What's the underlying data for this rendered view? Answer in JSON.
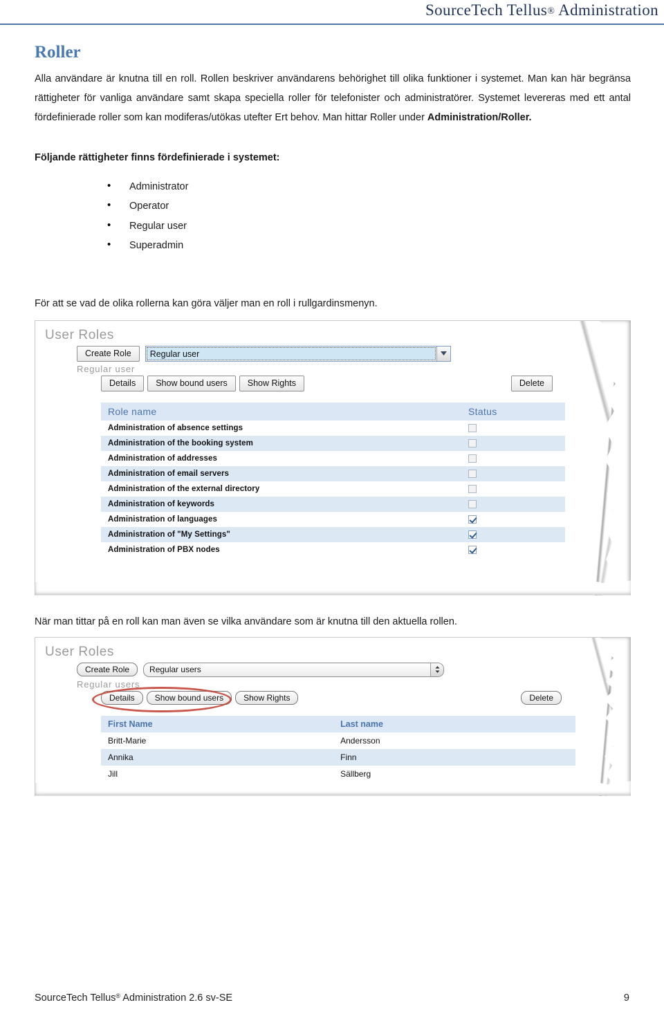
{
  "header": {
    "title": "SourceTech Tellus",
    "registered": "®",
    "title_tail": " Administration"
  },
  "section": {
    "heading": "Roller",
    "paragraph_1": "Alla användare är knutna till en roll. Rollen beskriver användarens behörighet till olika funktioner i systemet. Man kan här begränsa rättigheter för vanliga användare samt skapa speciella roller för telefonister och administratörer. Systemet levereras med ett antal fördefinierade roller som kan modiferas/utökas utefter Ert behov. Man hittar Roller under ",
    "paragraph_1_bold": "Administration/Roller.",
    "lead": "Följande rättigheter finns fördefinierade i systemet:",
    "bullets": [
      "Administrator",
      "Operator",
      "Regular user",
      "Superadmin"
    ],
    "after_bullets": "För att se vad de olika rollerna kan göra väljer man en roll i rullgardinsmenyn.",
    "between_shots": "När man tittar på en roll kan man även se vilka användare som är knutna till den aktuella rollen."
  },
  "shot1": {
    "title": "User Roles",
    "create_role_label": "Create Role",
    "dropdown_value": "Regular user",
    "dropdown_icon": "chevron-down-icon",
    "role_label": "Regular user",
    "buttons": {
      "details": "Details",
      "show_bound_users": "Show bound users",
      "show_rights": "Show Rights",
      "delete": "Delete"
    },
    "table": {
      "columns": [
        "Role name",
        "Status"
      ],
      "rows": [
        {
          "name": "Administration of absence settings",
          "checked": false
        },
        {
          "name": "Administration of the booking system",
          "checked": false
        },
        {
          "name": "Administration of addresses",
          "checked": false
        },
        {
          "name": "Administration of email servers",
          "checked": false
        },
        {
          "name": "Administration of the external directory",
          "checked": false
        },
        {
          "name": "Administration of keywords",
          "checked": false
        },
        {
          "name": "Administration of languages",
          "checked": true
        },
        {
          "name": "Administration of \"My Settings\"",
          "checked": true
        },
        {
          "name": "Administration of PBX nodes",
          "checked": true
        }
      ]
    }
  },
  "shot2": {
    "title": "User Roles",
    "create_role_label": "Create Role",
    "dropdown_value": "Regular users",
    "dropdown_icon": "stepper-updown-icon",
    "role_label": "Regular users",
    "buttons": {
      "details": "Details",
      "show_bound_users": "Show bound users",
      "show_rights": "Show Rights",
      "delete": "Delete"
    },
    "annotation": "red-ellipse-highlight",
    "table": {
      "columns": [
        "First Name",
        "Last name"
      ],
      "rows": [
        {
          "first": "Britt-Marie",
          "last": "Andersson"
        },
        {
          "first": "Annika",
          "last": "Finn"
        },
        {
          "first": "Jill",
          "last": "Sällberg"
        }
      ]
    }
  },
  "footer": {
    "left": "SourceTech Tellus",
    "left_reg": "®",
    "left_tail": " Administration 2.6 sv-SE",
    "page_number": "9"
  },
  "colors": {
    "header_title": "#1f3358",
    "rule": "#4e76a8",
    "heading": "#4a7ab4",
    "table_header_bg": "#dbe7f4",
    "table_header_text": "#4a74ab",
    "row_alt_bg": "#dde8f5",
    "highlight": "#c0392b"
  }
}
